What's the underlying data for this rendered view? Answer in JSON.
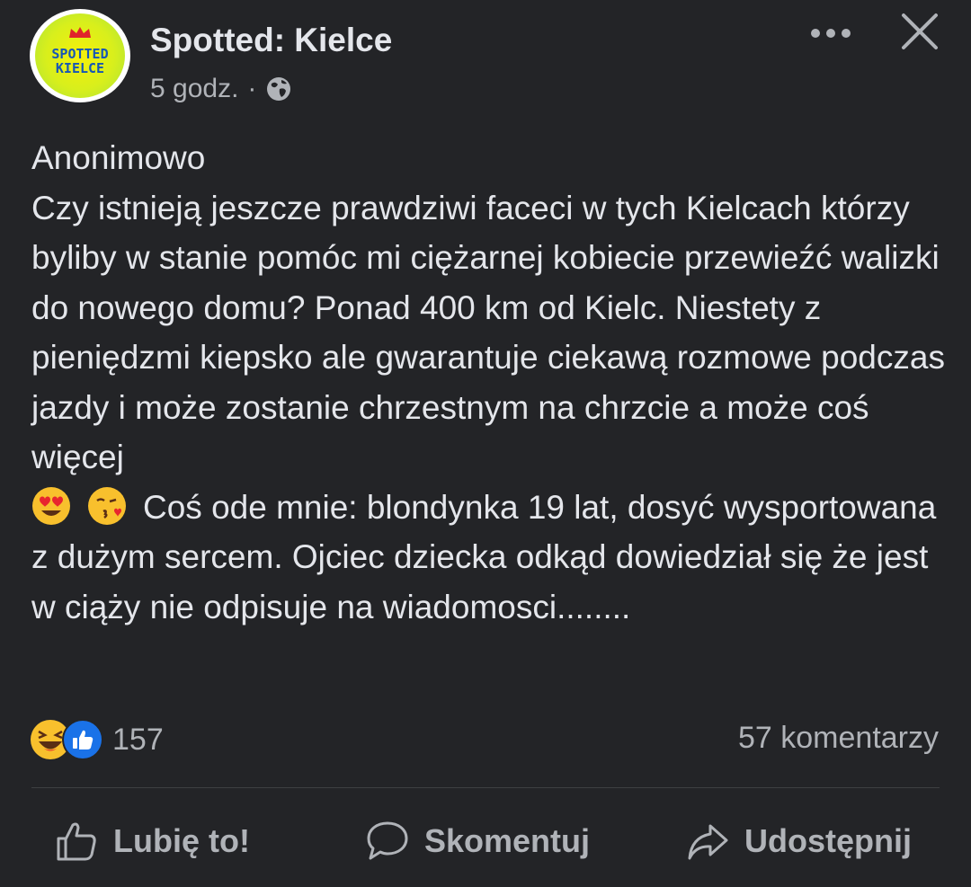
{
  "header": {
    "page_name": "Spotted: Kielce",
    "logo_line1": "SPOTTED",
    "logo_line2": "KIELCE",
    "timestamp": "5 godz.",
    "separator": "·",
    "privacy_icon": "globe-icon"
  },
  "post": {
    "paragraph1": "Anonimowo\nCzy istnieją jeszcze prawdziwi faceci w tych Kielcach którzy byliby w stanie pomóc mi ciężarnej kobiecie przewieźć walizki do nowego domu? Ponad 400 km od Kielc. Niestety z pieniędzmi kiepsko ale gwarantuje ciekawą rozmowe podczas jazdy i może zostanie chrzestnym na chrzcie a może coś więcej",
    "emoji1": "heart-eyes-emoji",
    "emoji2": "kissing-heart-emoji",
    "paragraph2": "Coś ode mnie: blondynka 19 lat, dosyć wysportowana z dużym sercem. Ojciec dziecka odkąd dowiedział się że jest w ciąży nie odpisuje na wiadomosci........"
  },
  "stats": {
    "reaction_icons": [
      "laughing-emoji",
      "like-icon"
    ],
    "reaction_count": "157",
    "comments": "57 komentarzy"
  },
  "actions": {
    "like": "Lubię to!",
    "comment": "Skomentuj",
    "share": "Udostępnij"
  },
  "colors": {
    "background": "#232427",
    "text": "#e4e6eb",
    "secondary": "#b0b3b8",
    "logo_blue": "#1656b6"
  }
}
